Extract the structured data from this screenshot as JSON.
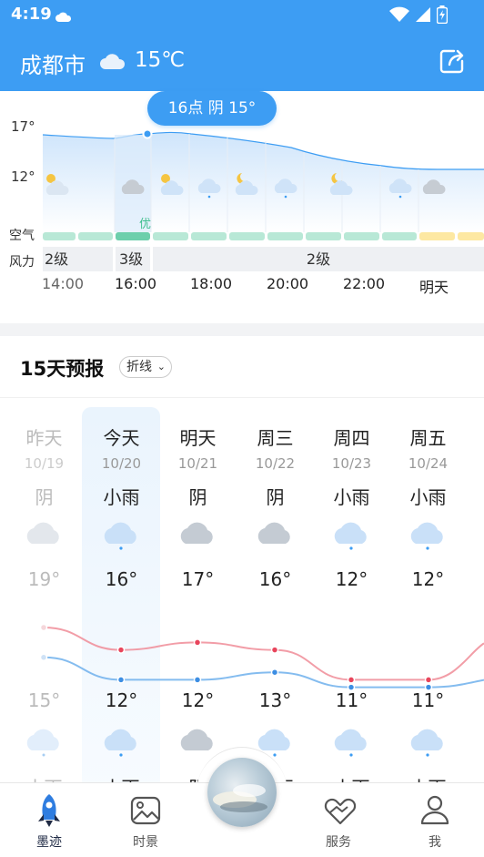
{
  "status_bar": {
    "time": "4:19"
  },
  "header": {
    "city": "成都市",
    "temp": "15℃"
  },
  "hourly": {
    "tooltip": "16点 阴 15°",
    "y_labels": [
      "17°",
      "12°"
    ],
    "air_label": "空气",
    "wind_label": "风力",
    "air_quality_active": "优",
    "wind": [
      "2级",
      "3级",
      "2级"
    ],
    "hours": [
      "14:00",
      "16:00",
      "18:00",
      "20:00",
      "22:00",
      "明天"
    ]
  },
  "daily": {
    "title": "15天预报",
    "mode": "折线",
    "days": [
      {
        "name": "昨天",
        "date": "10/19",
        "cond_day": "阴",
        "high": "19°",
        "low": "15°",
        "cond_night": "小雨"
      },
      {
        "name": "今天",
        "date": "10/20",
        "cond_day": "小雨",
        "high": "16°",
        "low": "12°",
        "cond_night": "小雨"
      },
      {
        "name": "明天",
        "date": "10/21",
        "cond_day": "阴",
        "high": "17°",
        "low": "12°",
        "cond_night": "阴"
      },
      {
        "name": "周三",
        "date": "10/22",
        "cond_day": "阴",
        "high": "16°",
        "low": "13°",
        "cond_night": "小雨"
      },
      {
        "name": "周四",
        "date": "10/23",
        "cond_day": "小雨",
        "high": "12°",
        "low": "11°",
        "cond_night": "小雨"
      },
      {
        "name": "周五",
        "date": "10/24",
        "cond_day": "小雨",
        "high": "12°",
        "low": "11°",
        "cond_night": "小雨"
      }
    ]
  },
  "nav": [
    {
      "label": "墨迹",
      "icon": "rocket-icon"
    },
    {
      "label": "时景",
      "icon": "picture-icon"
    },
    {
      "label": "服务",
      "icon": "heart-hands-icon"
    },
    {
      "label": "我",
      "icon": "person-icon"
    }
  ],
  "colors": {
    "accent": "#3d9df3",
    "high_line": "#f08c98",
    "low_line": "#6fb0ec"
  },
  "chart_data": {
    "type": "line",
    "categories": [
      "昨天",
      "今天",
      "明天",
      "周三",
      "周四",
      "周五"
    ],
    "series": [
      {
        "values": [
          19,
          16,
          17,
          16,
          12,
          12
        ]
      },
      {
        "values": [
          15,
          12,
          12,
          13,
          11,
          11
        ]
      }
    ]
  }
}
